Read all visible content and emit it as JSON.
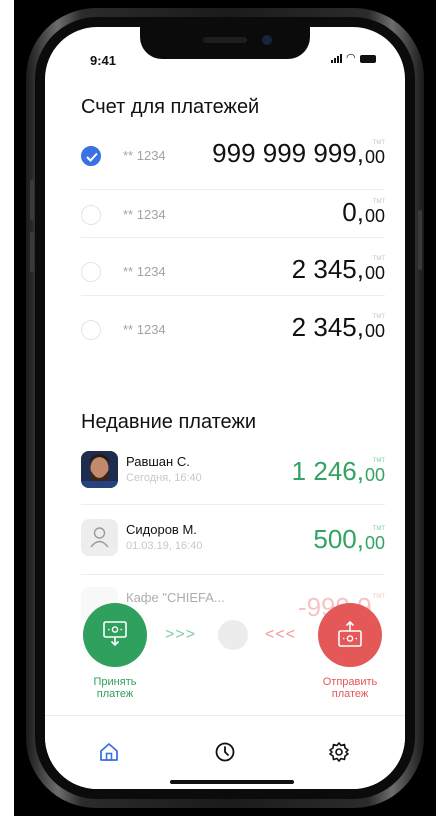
{
  "status_bar": {
    "time": "9:41"
  },
  "accounts": {
    "title": "Счет для платежей",
    "currency": "TMT",
    "items": [
      {
        "number": "** 1234",
        "amount_main": "999 999 999,",
        "amount_cents": "00",
        "selected": true
      },
      {
        "number": "** 1234",
        "amount_main": "0,",
        "amount_cents": "00",
        "selected": false
      },
      {
        "number": "** 1234",
        "amount_main": "2 345,",
        "amount_cents": "00",
        "selected": false
      },
      {
        "number": "** 1234",
        "amount_main": "2 345,",
        "amount_cents": "00",
        "selected": false
      }
    ]
  },
  "recent": {
    "title": "Недавние платежи",
    "currency": "TMT",
    "items": [
      {
        "name": "Равшан С.",
        "date": "Сегодня, 16:40",
        "amount_main": "1 246,",
        "amount_cents": "00",
        "avatar": "photo"
      },
      {
        "name": "Сидоров М.",
        "date": "01.03.19, 16:40",
        "amount_main": "500,",
        "amount_cents": "00",
        "avatar": "user-placeholder-icon"
      },
      {
        "name": "Кафе \"CHIEFA...",
        "date": "",
        "amount_main": "-999 9",
        "amount_cents": "",
        "avatar": "faded"
      }
    ]
  },
  "actions": {
    "receive_label": "Принять платеж",
    "send_label": "Отправить платеж",
    "swipe_right": ">>>",
    "swipe_left": "<<<",
    "receive_color": "#2fa05e",
    "send_color": "#e45858"
  },
  "tabs": [
    {
      "icon": "home-icon",
      "active": true
    },
    {
      "icon": "clock-icon",
      "active": false
    },
    {
      "icon": "gear-icon",
      "active": false
    }
  ],
  "colors": {
    "accent": "#3a72e4",
    "positive": "#33a363"
  }
}
